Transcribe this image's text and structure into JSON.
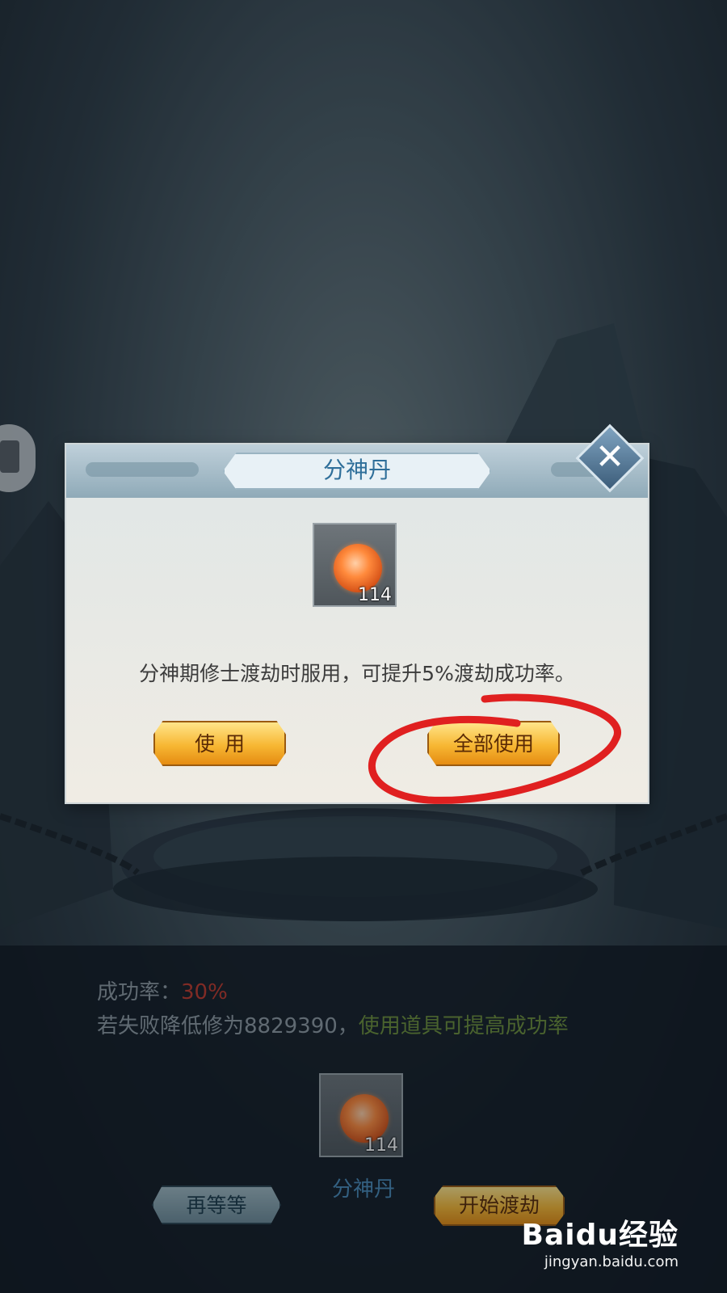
{
  "dialog": {
    "title": "分神丹",
    "item_count": "114",
    "description": "分神期修士渡劫时服用，可提升5%渡劫成功率。",
    "use_label": "使用",
    "use_all_label": "全部使用",
    "close_icon": "close-icon"
  },
  "info": {
    "rate_label": "成功率：",
    "rate_value": "30%",
    "fail_text": "若失败降低修为8829390，",
    "fail_hint": "使用道具可提高成功率",
    "item_count": "114",
    "item_name": "分神丹"
  },
  "actions": {
    "wait_label": "再等等",
    "start_label": "开始渡劫"
  },
  "watermark": {
    "logo": "Baidu经验",
    "url": "jingyan.baidu.com"
  },
  "colors": {
    "rate_red": "#c0392b",
    "hint_green": "#6d8f3a",
    "title_blue": "#2f6f9a",
    "annotation_red": "#e02020"
  }
}
